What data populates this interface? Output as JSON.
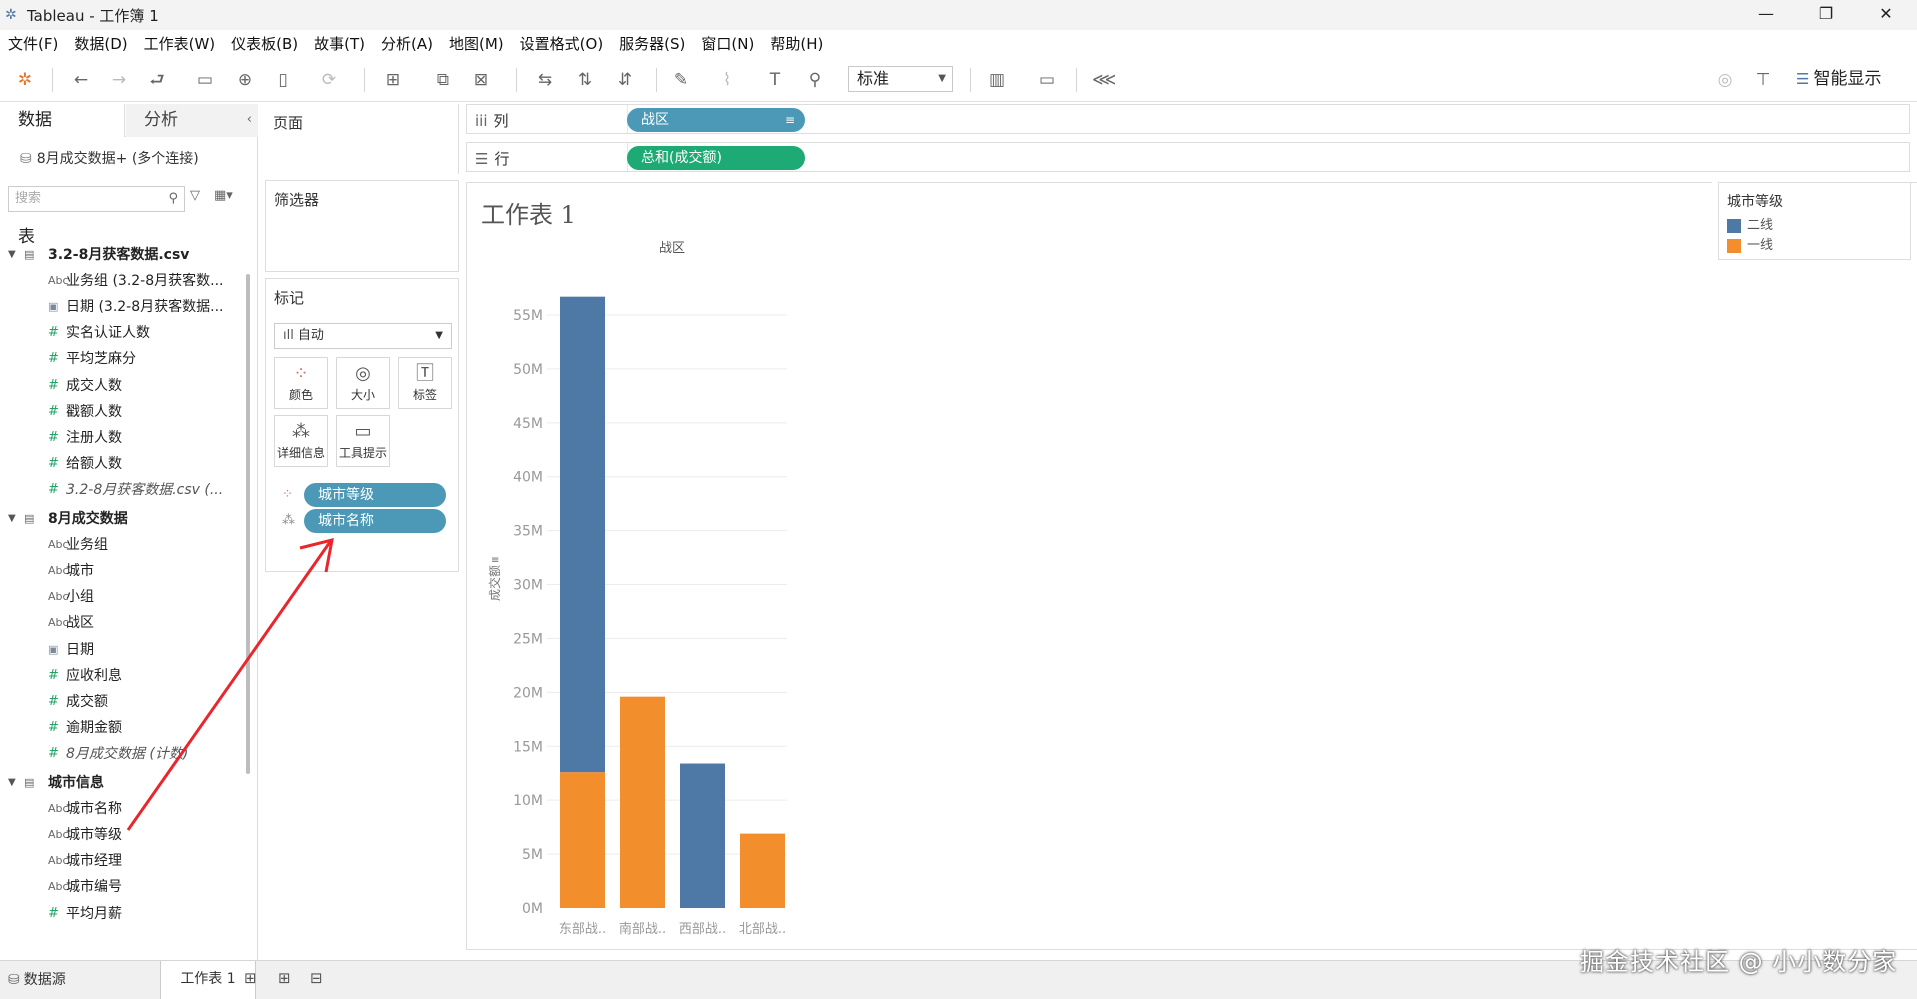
{
  "window": {
    "title": "Tableau - 工作簿 1",
    "min": "—",
    "max": "❐",
    "close": "✕"
  },
  "menu": [
    "文件(F)",
    "数据(D)",
    "工作表(W)",
    "仪表板(B)",
    "故事(T)",
    "分析(A)",
    "地图(M)",
    "设置格式(O)",
    "服务器(S)",
    "窗口(N)",
    "帮助(H)"
  ],
  "toolbar": {
    "fit_select": "标准",
    "smart_show": "智能显示"
  },
  "datapane": {
    "tab_data": "数据",
    "tab_analysis": "分析",
    "connection": "8月成交数据+ (多个连接)",
    "search_placeholder": "搜索",
    "tables_header": "表",
    "rows": [
      {
        "type": "table",
        "text": "3.2-8月获客数据.csv"
      },
      {
        "type": "dim-abc",
        "text": "业务组 (3.2-8月获客数..."
      },
      {
        "type": "dim-date",
        "text": "日期 (3.2-8月获客数据..."
      },
      {
        "type": "measure",
        "text": "实名认证人数"
      },
      {
        "type": "measure",
        "text": "平均芝麻分"
      },
      {
        "type": "measure",
        "text": "成交人数"
      },
      {
        "type": "measure",
        "text": "戳额人数"
      },
      {
        "type": "measure",
        "text": "注册人数"
      },
      {
        "type": "measure",
        "text": "给额人数"
      },
      {
        "type": "measure-italic",
        "text": "3.2-8月获客数据.csv (..."
      },
      {
        "type": "table",
        "text": "8月成交数据"
      },
      {
        "type": "dim-abc",
        "text": "业务组"
      },
      {
        "type": "dim-abc",
        "text": "城市"
      },
      {
        "type": "dim-abc",
        "text": "小组"
      },
      {
        "type": "dim-abc",
        "text": "战区"
      },
      {
        "type": "dim-date",
        "text": "日期"
      },
      {
        "type": "measure",
        "text": "应收利息"
      },
      {
        "type": "measure",
        "text": "成交额"
      },
      {
        "type": "measure",
        "text": "逾期金额"
      },
      {
        "type": "measure-italic",
        "text": "8月成交数据 (计数)"
      },
      {
        "type": "table",
        "text": "城市信息"
      },
      {
        "type": "dim-abc",
        "text": "城市名称"
      },
      {
        "type": "dim-abc",
        "text": "城市等级"
      },
      {
        "type": "dim-abc",
        "text": "城市经理"
      },
      {
        "type": "dim-abc",
        "text": "城市编号"
      },
      {
        "type": "measure",
        "text": "平均月薪"
      }
    ]
  },
  "cards": {
    "pages": "页面",
    "filters": "筛选器",
    "marks": "标记",
    "marks_type": "自动",
    "mark_buttons": [
      "颜色",
      "大小",
      "标签",
      "详细信息",
      "工具提示"
    ],
    "mark_pills": [
      "城市等级",
      "城市名称"
    ]
  },
  "shelves": {
    "columns_label": "列",
    "columns_pill": "战区",
    "rows_label": "行",
    "rows_pill": "总和(成交额)"
  },
  "view": {
    "title": "工作表 1"
  },
  "chart_data": {
    "type": "bar",
    "stacked": true,
    "column_header": "战区",
    "ylabel": "成交额",
    "ylim": [
      0,
      60000000
    ],
    "yticks": [
      "0M",
      "5M",
      "10M",
      "15M",
      "20M",
      "25M",
      "30M",
      "35M",
      "40M",
      "45M",
      "50M",
      "55M"
    ],
    "categories": [
      "东部战..",
      "南部战..",
      "西部战..",
      "北部战.."
    ],
    "series": [
      {
        "name": "一线",
        "color": "#f28e2b",
        "values": [
          12600000,
          19600000,
          0,
          6900000
        ]
      },
      {
        "name": "二线",
        "color": "#4e79a7",
        "values": [
          44100000,
          0,
          13400000,
          0
        ]
      }
    ]
  },
  "legend": {
    "title": "城市等级",
    "items": [
      {
        "label": "二线",
        "color": "#4e79a7"
      },
      {
        "label": "一线",
        "color": "#f28e2b"
      }
    ]
  },
  "bottom": {
    "source": "数据源",
    "sheet": "工作表 1"
  },
  "watermark": "掘金技术社区 @ 小小数分家",
  "annotation_color": "#e8262c"
}
